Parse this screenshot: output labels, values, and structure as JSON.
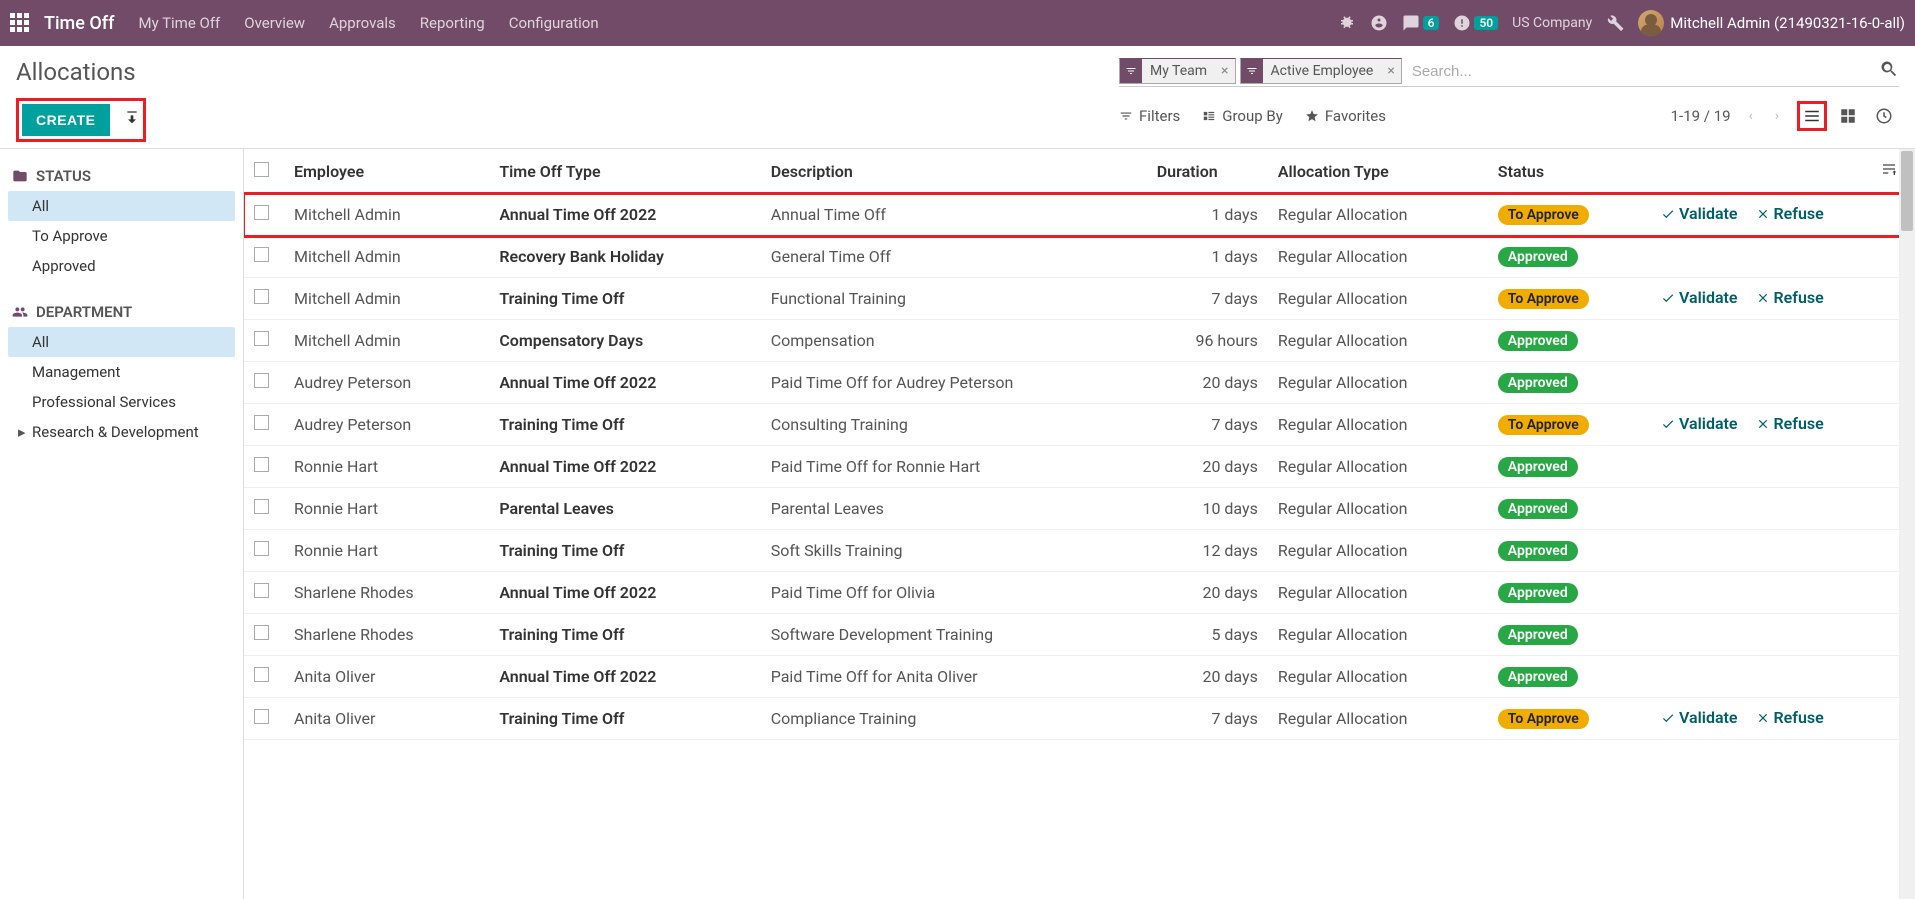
{
  "topbar": {
    "app_title": "Time Off",
    "nav": [
      "My Time Off",
      "Overview",
      "Approvals",
      "Reporting",
      "Configuration"
    ],
    "messages_badge": "6",
    "activities_badge": "50",
    "company": "US Company",
    "user_name": "Mitchell Admin (21490321-16-0-all)"
  },
  "breadcrumb": "Allocations",
  "buttons": {
    "create": "CREATE"
  },
  "search": {
    "facets": [
      "My Team",
      "Active Employee"
    ],
    "placeholder": "Search..."
  },
  "toolbar": {
    "filters": "Filters",
    "group_by": "Group By",
    "favorites": "Favorites",
    "pager": "1-19 / 19"
  },
  "sidebar": {
    "status_label": "STATUS",
    "status_items": [
      "All",
      "To Approve",
      "Approved"
    ],
    "department_label": "DEPARTMENT",
    "department_items": [
      "All",
      "Management",
      "Professional Services",
      "Research & Development"
    ]
  },
  "columns": {
    "employee": "Employee",
    "type": "Time Off Type",
    "description": "Description",
    "duration": "Duration",
    "allocation_type": "Allocation Type",
    "status": "Status"
  },
  "actions": {
    "validate": "Validate",
    "refuse": "Refuse"
  },
  "status_labels": {
    "to_approve": "To Approve",
    "approved": "Approved"
  },
  "rows": [
    {
      "employee": "Mitchell Admin",
      "type": "Annual Time Off 2022",
      "description": "Annual Time Off",
      "duration": "1 days",
      "allocation": "Regular Allocation",
      "status": "to_approve",
      "highlight": true
    },
    {
      "employee": "Mitchell Admin",
      "type": "Recovery Bank Holiday",
      "description": "General Time Off",
      "duration": "1 days",
      "allocation": "Regular Allocation",
      "status": "approved"
    },
    {
      "employee": "Mitchell Admin",
      "type": "Training Time Off",
      "description": "Functional Training",
      "duration": "7 days",
      "allocation": "Regular Allocation",
      "status": "to_approve"
    },
    {
      "employee": "Mitchell Admin",
      "type": "Compensatory Days",
      "description": "Compensation",
      "duration": "96 hours",
      "allocation": "Regular Allocation",
      "status": "approved"
    },
    {
      "employee": "Audrey Peterson",
      "type": "Annual Time Off 2022",
      "description": "Paid Time Off for Audrey Peterson",
      "duration": "20 days",
      "allocation": "Regular Allocation",
      "status": "approved"
    },
    {
      "employee": "Audrey Peterson",
      "type": "Training Time Off",
      "description": "Consulting Training",
      "duration": "7 days",
      "allocation": "Regular Allocation",
      "status": "to_approve"
    },
    {
      "employee": "Ronnie Hart",
      "type": "Annual Time Off 2022",
      "description": "Paid Time Off for Ronnie Hart",
      "duration": "20 days",
      "allocation": "Regular Allocation",
      "status": "approved"
    },
    {
      "employee": "Ronnie Hart",
      "type": "Parental Leaves",
      "description": "Parental Leaves",
      "duration": "10 days",
      "allocation": "Regular Allocation",
      "status": "approved"
    },
    {
      "employee": "Ronnie Hart",
      "type": "Training Time Off",
      "description": "Soft Skills Training",
      "duration": "12 days",
      "allocation": "Regular Allocation",
      "status": "approved"
    },
    {
      "employee": "Sharlene Rhodes",
      "type": "Annual Time Off 2022",
      "description": "Paid Time Off for Olivia",
      "duration": "20 days",
      "allocation": "Regular Allocation",
      "status": "approved"
    },
    {
      "employee": "Sharlene Rhodes",
      "type": "Training Time Off",
      "description": "Software Development Training",
      "duration": "5 days",
      "allocation": "Regular Allocation",
      "status": "approved"
    },
    {
      "employee": "Anita Oliver",
      "type": "Annual Time Off 2022",
      "description": "Paid Time Off for Anita Oliver",
      "duration": "20 days",
      "allocation": "Regular Allocation",
      "status": "approved"
    },
    {
      "employee": "Anita Oliver",
      "type": "Training Time Off",
      "description": "Compliance Training",
      "duration": "7 days",
      "allocation": "Regular Allocation",
      "status": "to_approve"
    }
  ]
}
